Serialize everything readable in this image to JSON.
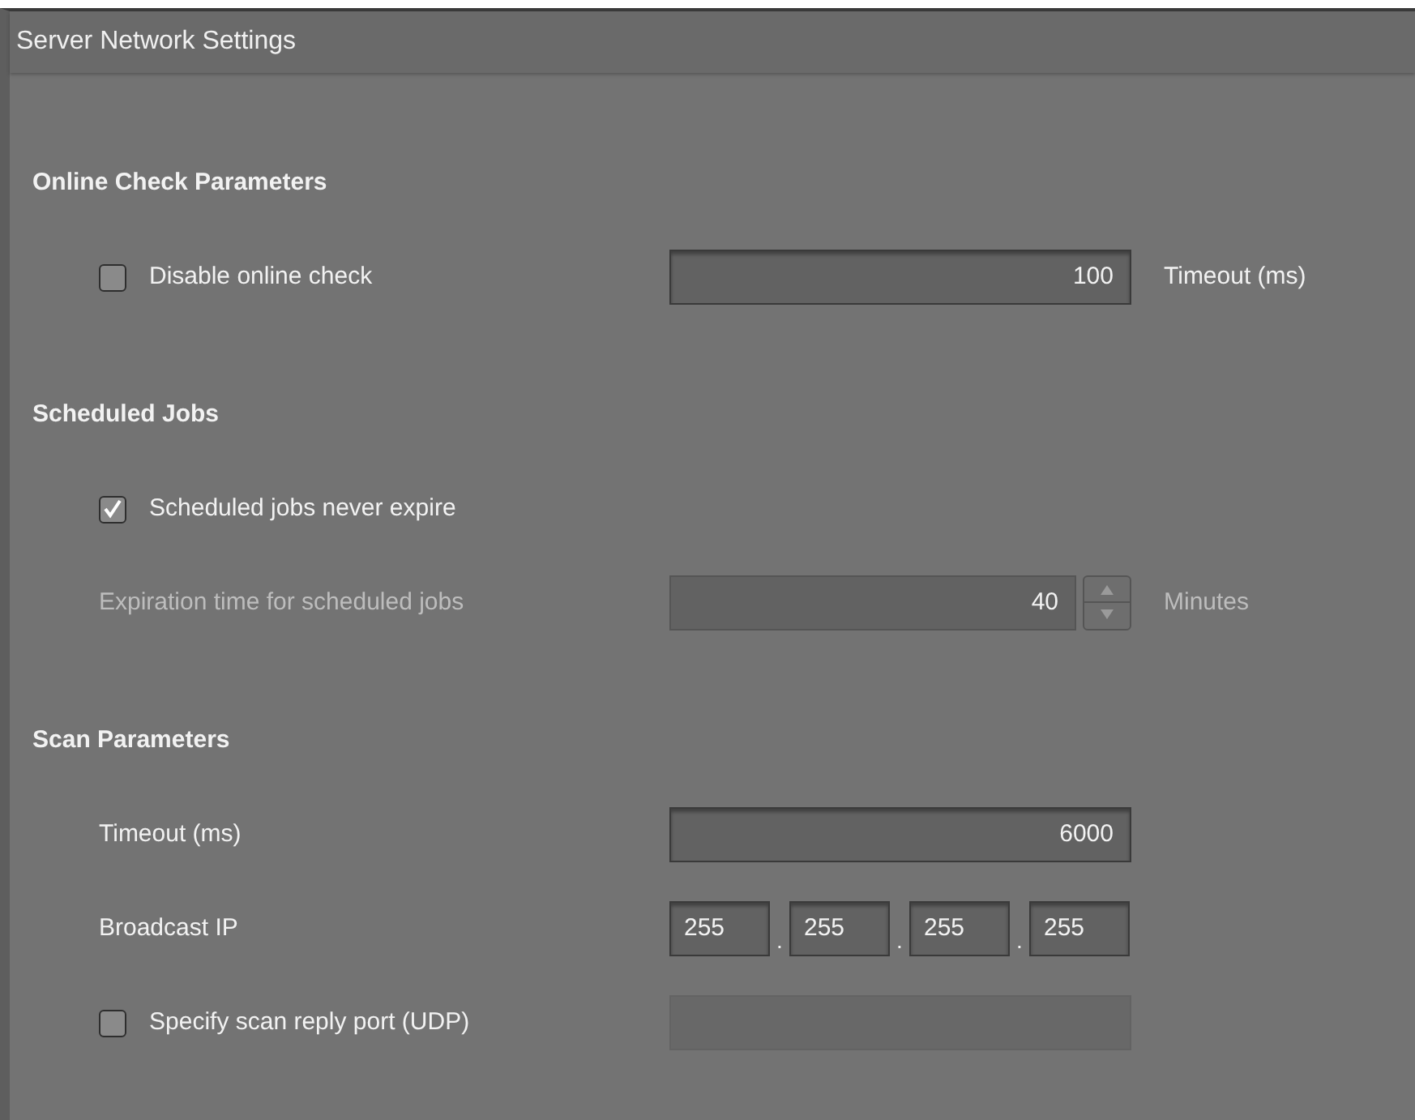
{
  "window": {
    "title": "Server Network Settings"
  },
  "sections": [
    {
      "heading": "Online Check Parameters",
      "rows": [
        {
          "kind": "checkbox",
          "label": "Disable online check",
          "checked": false,
          "field": {
            "value": "100",
            "disabled": false
          },
          "unit": "Timeout (ms)"
        }
      ]
    },
    {
      "heading": "Scheduled Jobs",
      "rows": [
        {
          "kind": "checkbox",
          "label": "Scheduled jobs never expire",
          "checked": true
        },
        {
          "kind": "spinner",
          "label": "Expiration time for scheduled jobs",
          "value": "40",
          "unit": "Minutes",
          "disabled": true
        }
      ]
    },
    {
      "heading": "Scan Parameters",
      "rows": [
        {
          "kind": "text",
          "label": "Timeout (ms)",
          "value": "6000"
        },
        {
          "kind": "ip",
          "label": "Broadcast IP",
          "octets": [
            "255",
            "255",
            "255",
            "255"
          ],
          "separator": "."
        },
        {
          "kind": "checkbox",
          "label": "Specify scan reply port (UDP)",
          "checked": false,
          "field": {
            "disabled": true
          }
        }
      ]
    }
  ]
}
